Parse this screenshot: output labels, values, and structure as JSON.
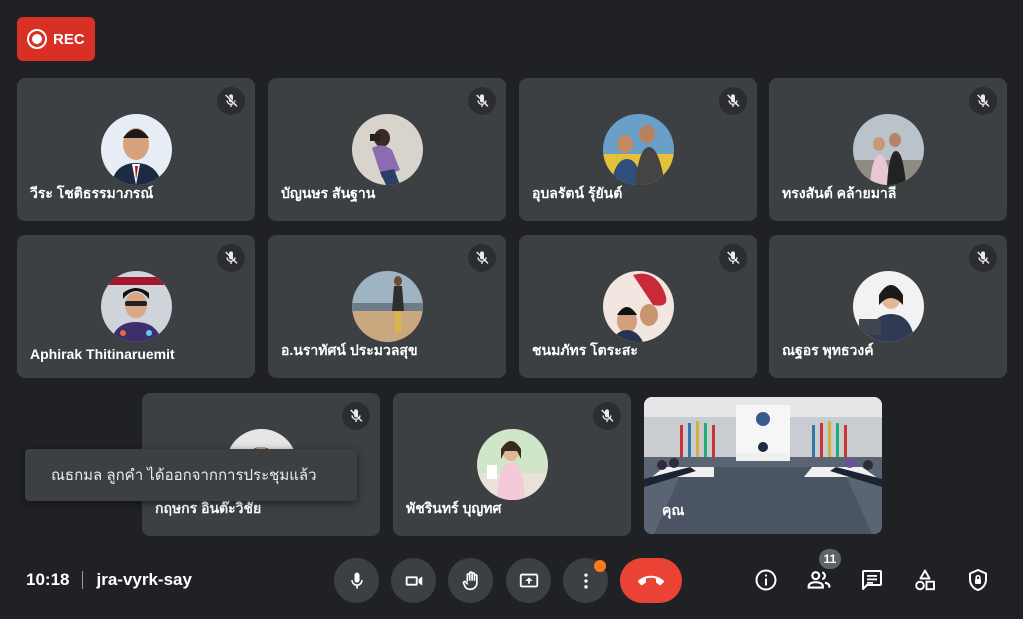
{
  "recording": {
    "label": "REC"
  },
  "participants": [
    {
      "name": "วีระ โชติธรรมาภรณ์"
    },
    {
      "name": "บัญนษร สันฐาน"
    },
    {
      "name": "อุบลรัตน์ รุ้ยันต์"
    },
    {
      "name": "ทรงสันต์ คล้ายมาลี"
    },
    {
      "name": "Aphirak Thitinaruemit"
    },
    {
      "name": "อ.นราทัศน์ ประมวลสุข"
    },
    {
      "name": "ชนมภัทร โตระสะ"
    },
    {
      "name": "ณฐอร พุทธวงค์"
    },
    {
      "name": "กฤษกร อินต๊ะวิชัย"
    },
    {
      "name": "พัชรินทร์ บุญทศ"
    }
  ],
  "self_view": {
    "name": "คุณ"
  },
  "toast": {
    "message": "ณธกมล ลูกคำ ได้ออกจากการประชุมแล้ว"
  },
  "meeting": {
    "time": "10:18",
    "code": "jra-vyrk-say"
  },
  "people_count": "11",
  "colors": {
    "background": "#202124",
    "tile": "#3c4043",
    "rec": "#d93025",
    "end_call": "#ea4335",
    "notification": "#fa7b17"
  }
}
